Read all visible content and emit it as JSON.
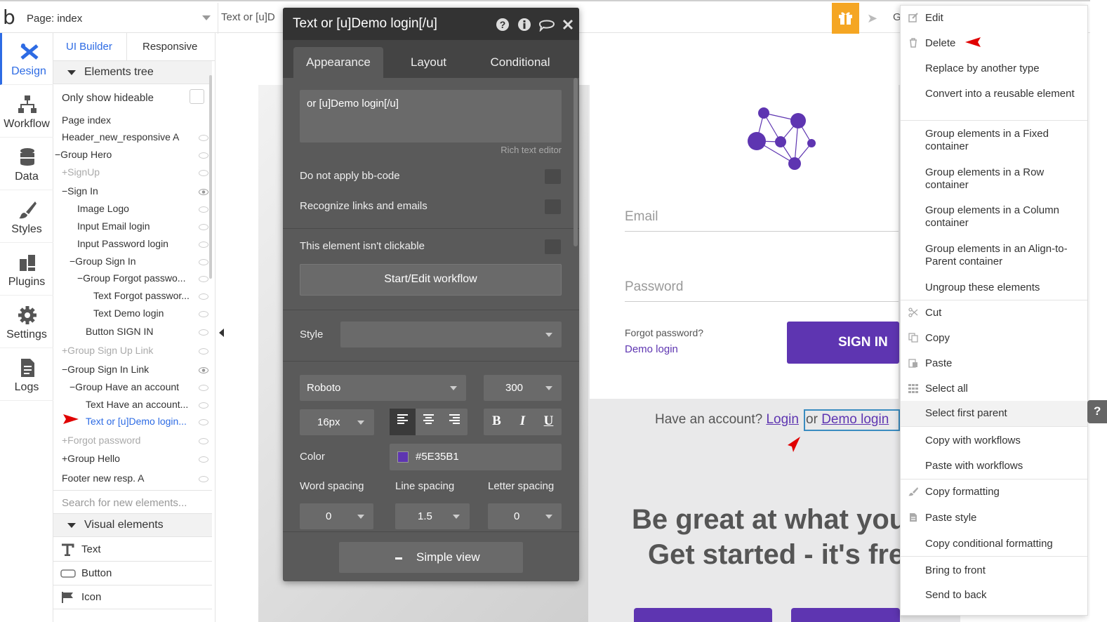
{
  "topbar": {
    "logo": "b",
    "page_label": "Page: index",
    "element_label": "Text or [u]D",
    "right_label": "G"
  },
  "rail": [
    {
      "label": "Design",
      "icon": "design-icon",
      "active": true
    },
    {
      "label": "Workflow",
      "icon": "workflow-icon"
    },
    {
      "label": "Data",
      "icon": "database-icon"
    },
    {
      "label": "Styles",
      "icon": "brush-icon"
    },
    {
      "label": "Plugins",
      "icon": "plugin-icon"
    },
    {
      "label": "Settings",
      "icon": "gear-icon"
    },
    {
      "label": "Logs",
      "icon": "document-icon"
    }
  ],
  "panel": {
    "tab_ui": "UI Builder",
    "tab_responsive": "Responsive",
    "elements_tree": "Elements tree",
    "only_show_hideable": "Only show hideable",
    "tree": [
      {
        "label": "Page index"
      },
      {
        "label": "Header_new_responsive A"
      },
      {
        "label": "−Group Hero"
      },
      {
        "label": "+SignUp"
      },
      {
        "label": "−Sign In"
      },
      {
        "label": "Image Logo"
      },
      {
        "label": "Input Email login"
      },
      {
        "label": "Input Password login"
      },
      {
        "label": "−Group Sign In"
      },
      {
        "label": "−Group Forgot passwo..."
      },
      {
        "label": "Text Forgot passwor..."
      },
      {
        "label": "Text Demo login"
      },
      {
        "label": "Button SIGN IN"
      },
      {
        "label": "+Group Sign Up Link"
      },
      {
        "label": "−Group Sign In Link"
      },
      {
        "label": "−Group Have an account"
      },
      {
        "label": "Text Have an account..."
      },
      {
        "label": "Text or [u]Demo login..."
      },
      {
        "label": "+Forgot password"
      },
      {
        "label": "+Group Hello"
      },
      {
        "label": "Footer new resp. A"
      }
    ],
    "search_placeholder": "Search for new elements...",
    "visual_elements": "Visual elements",
    "visual": [
      {
        "label": "Text",
        "icon": "text-icon"
      },
      {
        "label": "Button",
        "icon": "button-icon"
      },
      {
        "label": "Icon",
        "icon": "flag-icon"
      }
    ]
  },
  "editor": {
    "title": "Text or [u]Demo login[/u]",
    "tabs": [
      "Appearance",
      "Layout",
      "Conditional"
    ],
    "content": "or [u]Demo login[/u]",
    "rich_text_label": "Rich text editor",
    "do_not_apply_bbcode": "Do not apply bb-code",
    "recognize_links": "Recognize links and emails",
    "not_clickable": "This element isn't clickable",
    "workflow_button": "Start/Edit workflow",
    "style_label": "Style",
    "font": "Roboto",
    "weight": "300",
    "size": "16px",
    "color_label": "Color",
    "color_value": "#5E35B1",
    "word_spacing_label": "Word spacing",
    "line_spacing_label": "Line spacing",
    "letter_spacing_label": "Letter spacing",
    "word_spacing": "0",
    "line_spacing": "1.5",
    "letter_spacing": "0",
    "bold": "B",
    "italic": "I",
    "underline": "U",
    "simple_view": "Simple view"
  },
  "canvas": {
    "email_placeholder": "Email",
    "password_placeholder": "Password",
    "forgot": "Forgot password?",
    "demo_login": "Demo login",
    "sign_in": "SIGN IN",
    "have_account": "Have an account?",
    "login": "Login",
    "or": "or",
    "hero_line1": "Be great at what you d",
    "hero_line2": "Get started - it's free"
  },
  "context_menu": [
    {
      "label": "Edit",
      "icon": "edit-icon"
    },
    {
      "label": "Delete",
      "icon": "trash-icon"
    },
    {
      "label": "Replace by another type"
    },
    {
      "label": "Convert into a reusable element"
    },
    {
      "label": "Group elements in a Fixed container"
    },
    {
      "label": "Group elements in a Row container"
    },
    {
      "label": "Group elements in a Column container"
    },
    {
      "label": "Group elements in an Align-to-Parent container"
    },
    {
      "label": "Ungroup these elements"
    },
    {
      "label": "Cut",
      "icon": "scissors-icon"
    },
    {
      "label": "Copy",
      "icon": "copy-icon"
    },
    {
      "label": "Paste",
      "icon": "paste-icon"
    },
    {
      "label": "Select all",
      "icon": "grid-icon"
    },
    {
      "label": "Select first parent"
    },
    {
      "label": "Copy with workflows"
    },
    {
      "label": "Paste with workflows"
    },
    {
      "label": "Copy formatting",
      "icon": "brush-icon"
    },
    {
      "label": "Paste style",
      "icon": "paste-style-icon"
    },
    {
      "label": "Copy conditional formatting"
    },
    {
      "label": "Bring to front"
    },
    {
      "label": "Send to back"
    }
  ],
  "help_tab": "?",
  "colors": {
    "accent": "#2d6be4",
    "brand": "#5e35b1",
    "editor_bg": "#5a5a5a",
    "gift": "#f5a623",
    "annotation": "#e00000"
  }
}
